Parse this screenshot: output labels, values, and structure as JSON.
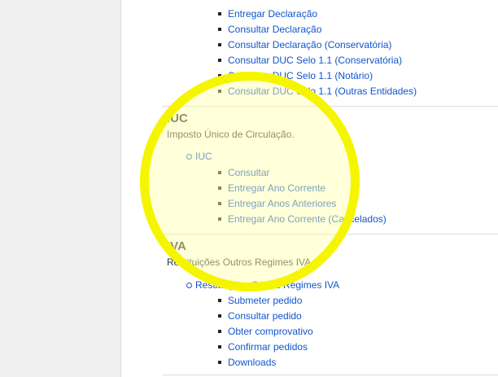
{
  "declaracao_links": [
    "Entregar Declaração",
    "Consultar Declaração",
    "Consultar Declaração (Conservatória)",
    "Consultar DUC Selo 1.1 (Conservatória)",
    "Consultar DUC Selo 1.1 (Notário)",
    "Consultar DUC Selo 1.1 (Outras Entidades)"
  ],
  "iuc": {
    "title": "IUC",
    "description": "Imposto Único de Circulação.",
    "group_label": "IUC",
    "links": [
      "Consultar",
      "Entregar Ano Corrente",
      "Entregar Anos Anteriores",
      "Entregar Ano Corrente (Cancelados)"
    ]
  },
  "iva": {
    "title": "IVA",
    "description": "Restituições Outros Regimes IVA",
    "group_label": "Restituições Outros Regimes IVA",
    "links": [
      "Submeter pedido",
      "Consultar pedido",
      "Obter comprovativo",
      "Confirmar pedidos",
      "Downloads"
    ]
  },
  "colors": {
    "link": "#1155cc",
    "highlight_ring": "#f5f500",
    "highlight_fill": "#ffffaa"
  }
}
